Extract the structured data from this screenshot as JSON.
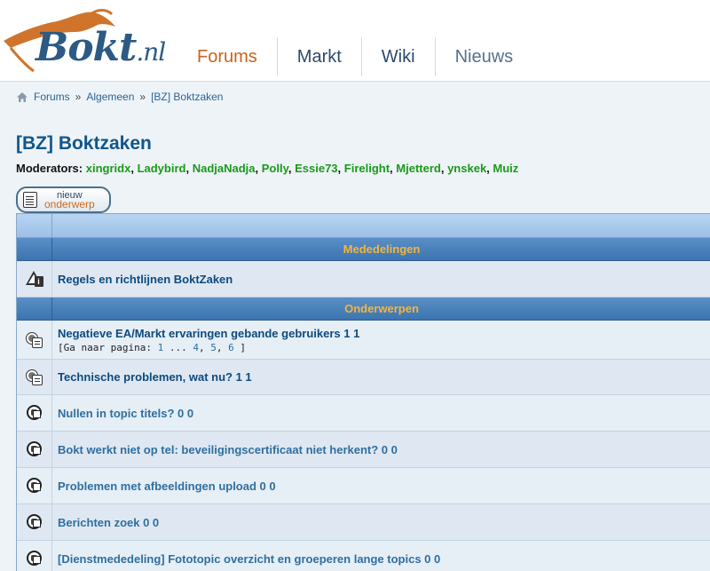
{
  "header": {
    "logo_main": "Bokt",
    "logo_suffix": ".nl",
    "nav": [
      "Forums",
      "Markt",
      "Wiki",
      "Nieuws"
    ]
  },
  "breadcrumb": {
    "items": [
      "Forums",
      "Algemeen",
      "[BZ] Boktzaken"
    ],
    "separator": "»"
  },
  "forum": {
    "title": "[BZ] Boktzaken",
    "moderators_label": "Moderators:",
    "moderators": [
      "xingridx",
      "Ladybird",
      "NadjaNadja",
      "Polly",
      "Essie73",
      "Firelight",
      "Mjetterd",
      "ynskek",
      "Muiz"
    ]
  },
  "new_topic_button": {
    "line1": "nieuw",
    "line2": "onderwerp"
  },
  "sections": {
    "announcements": "Mededelingen",
    "topics": "Onderwerpen"
  },
  "announcements": [
    {
      "title": "Regels en richtlijnen BoktZaken",
      "icon": "info-icon"
    }
  ],
  "topics": [
    {
      "title": "Negatieve EA/Markt ervaringen gebande gebruikers 1 1",
      "icon": "sticky-icon",
      "pages_prefix": "[Ga naar pagina:",
      "pages": [
        "1",
        "...",
        "4",
        "5",
        "6"
      ],
      "pages_suffix": "]"
    },
    {
      "title": "Technische problemen, wat nu? 1 1",
      "icon": "sticky-icon"
    },
    {
      "title": "Nullen in topic titels? 0 0",
      "icon": "topic-icon"
    },
    {
      "title": "Bokt werkt niet op tel: beveiligingscertificaat niet herkent? 0 0",
      "icon": "topic-icon"
    },
    {
      "title": "Problemen met afbeeldingen upload 0 0",
      "icon": "topic-icon"
    },
    {
      "title": "Berichten zoek 0 0",
      "icon": "topic-icon"
    },
    {
      "title": "[Dienstmededeling] Fototopic overzicht en groeperen lange topics 0 0",
      "icon": "topic-icon"
    }
  ],
  "colors": {
    "accent_orange": "#c8641e",
    "title_blue": "#10568a",
    "moderator_green": "#1a9a1a",
    "section_header": "#3b74b0"
  }
}
